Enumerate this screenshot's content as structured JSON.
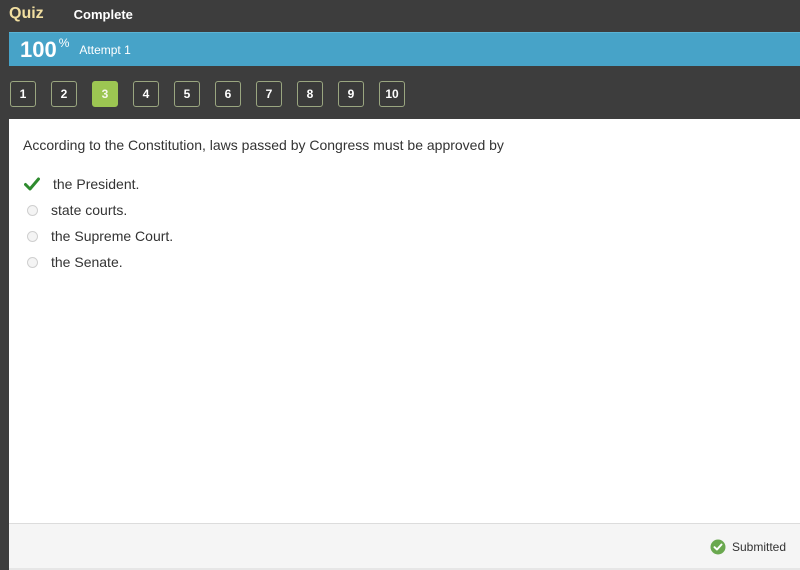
{
  "header": {
    "title": "Quiz",
    "status": "Complete"
  },
  "score": {
    "value": "100",
    "unit": "%",
    "attempt": "Attempt 1"
  },
  "question_nav": {
    "items": [
      "1",
      "2",
      "3",
      "4",
      "5",
      "6",
      "7",
      "8",
      "9",
      "10"
    ],
    "active": "3"
  },
  "question": {
    "text": "According to the Constitution, laws passed by Congress must be approved by",
    "answers": [
      {
        "label": "the President.",
        "state": "correct"
      },
      {
        "label": "state courts.",
        "state": "unselected"
      },
      {
        "label": "the Supreme Court.",
        "state": "unselected"
      },
      {
        "label": "the Senate.",
        "state": "unselected"
      }
    ]
  },
  "footer": {
    "status": "Submitted",
    "status_icon": "check-circle-icon"
  },
  "colors": {
    "accent_blue": "#47a3c8",
    "active_green": "#9cc652",
    "correct_green": "#2e8b2e",
    "quiz_title": "#f2dfa0"
  }
}
